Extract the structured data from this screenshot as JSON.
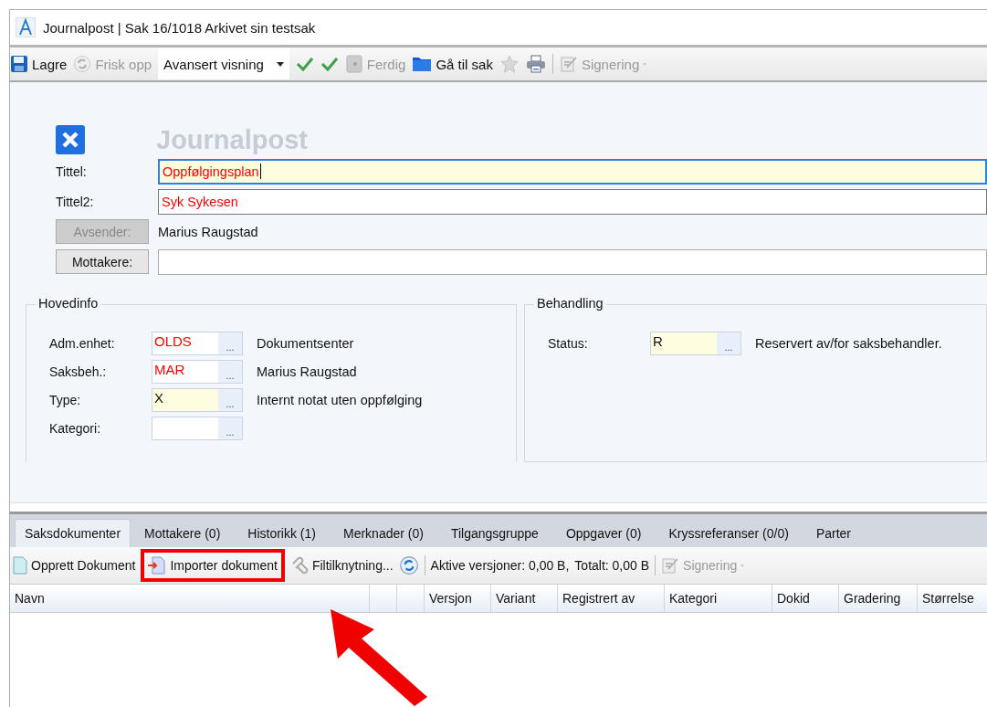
{
  "window": {
    "title": "Journalpost  | Sak 16/1018 Arkivet sin testsak"
  },
  "toolbar": [
    {
      "kind": "save",
      "label": "Lagre",
      "disabled": false
    },
    {
      "kind": "refresh",
      "label": "Frisk opp",
      "disabled": true
    },
    {
      "kind": "dropdown",
      "label": "Avansert visning"
    },
    {
      "kind": "check",
      "disabled": false
    },
    {
      "kind": "check",
      "disabled": false
    },
    {
      "kind": "finish",
      "label": "Ferdig",
      "disabled": true
    },
    {
      "kind": "folder",
      "label": "Gå til sak",
      "disabled": false
    },
    {
      "kind": "star",
      "disabled": true
    },
    {
      "kind": "print",
      "disabled": false
    },
    {
      "kind": "separator"
    },
    {
      "kind": "signing",
      "label": "Signering",
      "disabled": true
    }
  ],
  "form": {
    "heading": "Journalpost",
    "rows": [
      {
        "kind": "field",
        "label": "Tittel:",
        "value": "Oppfølgingsplan",
        "required": true,
        "highlighted": true,
        "focused": true
      },
      {
        "kind": "field",
        "label": "Tittel2:",
        "value": "Syk Sykesen",
        "required": true,
        "highlighted": false,
        "focused": false
      },
      {
        "kind": "button-text",
        "label": "Avsender:",
        "value": "Marius Raugstad",
        "disabled": true
      },
      {
        "kind": "button-field",
        "label": "Mottakere:",
        "disabled": false
      }
    ]
  },
  "hovedinfo": {
    "title": "Hovedinfo",
    "rows": [
      {
        "label": "Adm.enhet:",
        "value": "OLDS",
        "button": "...",
        "description": "Dokumentsenter",
        "required": true,
        "highlighted": false
      },
      {
        "label": "Saksbeh.:",
        "value": "MAR",
        "button": "...",
        "description": "Marius Raugstad",
        "required": true,
        "highlighted": false
      },
      {
        "label": "Type:",
        "value": "X",
        "button": "...",
        "description": "Internt notat uten oppfølging",
        "required": false,
        "highlighted": true
      },
      {
        "label": "Kategori:",
        "button": "...",
        "highlighted": false
      }
    ]
  },
  "behandling": {
    "title": "Behandling",
    "rows": [
      {
        "label": "Status:",
        "value": "R",
        "button": "...",
        "description": "Reservert av/for saksbehandler.",
        "required": false,
        "highlighted": true
      }
    ]
  },
  "tabs": [
    {
      "label": "Saksdokumenter",
      "selected": true
    },
    {
      "label": "Mottakere (0)",
      "selected": false
    },
    {
      "label": "Historikk (1)",
      "selected": false
    },
    {
      "label": "Merknader (0)",
      "selected": false
    },
    {
      "label": "Tilgangsgruppe",
      "selected": false
    },
    {
      "label": "Oppgaver (0)",
      "selected": false
    },
    {
      "label": "Kryssreferanser (0/0)",
      "selected": false
    },
    {
      "label": "Parter",
      "selected": false
    }
  ],
  "doc_toolbar": [
    {
      "kind": "new",
      "label": "Opprett Dokument",
      "marked": false
    },
    {
      "kind": "import",
      "label": "Importer dokument",
      "marked": true
    },
    {
      "kind": "attach",
      "label": "Filtilknytning...",
      "marked": false
    },
    {
      "kind": "refresh",
      "disabled": false
    },
    {
      "kind": "separator"
    },
    {
      "kind": "text",
      "label": "Aktive versjoner: 0,00 B,"
    },
    {
      "kind": "text",
      "label": "Totalt: 0,00 B"
    },
    {
      "kind": "separator"
    },
    {
      "kind": "signing",
      "label": "Signering",
      "disabled": true
    }
  ],
  "table": {
    "columns": [
      {
        "label": "Navn"
      },
      {},
      {},
      {
        "label": "Versjon"
      },
      {
        "label": "Variant"
      },
      {
        "label": "Registrert av"
      },
      {
        "label": "Kategori"
      },
      {
        "label": "Dokid"
      },
      {
        "label": "Gradering"
      },
      {
        "label": "Størrelse"
      }
    ]
  },
  "annotation": {
    "arrow": true
  }
}
